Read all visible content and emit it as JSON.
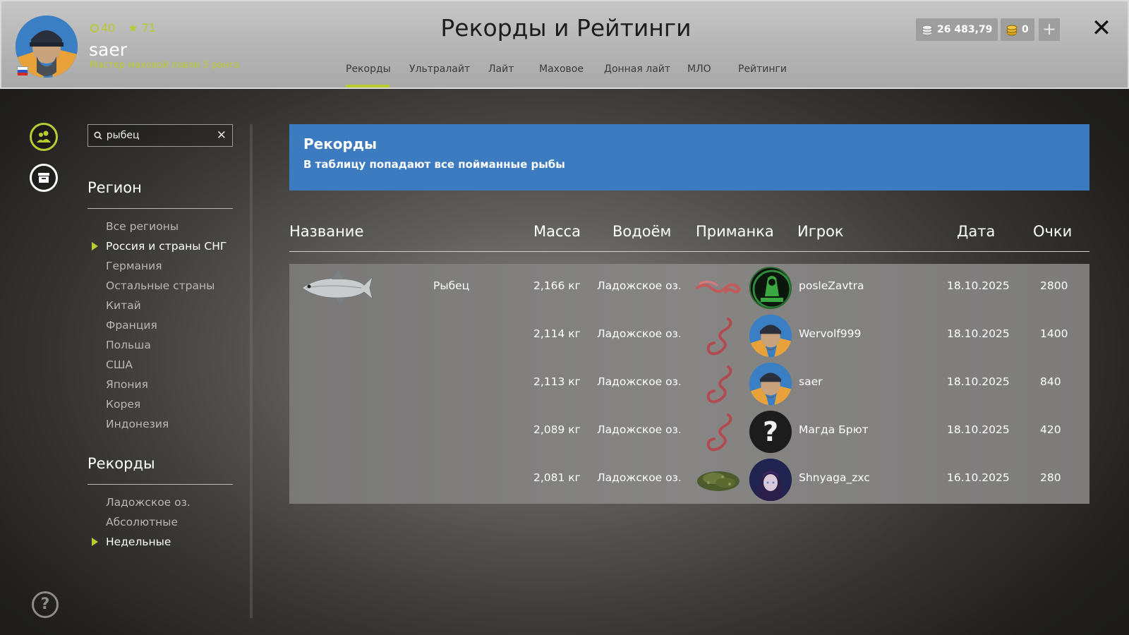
{
  "header": {
    "title": "Рекорды и Рейтинги",
    "player": {
      "level": "40",
      "stars": "71",
      "name": "saer",
      "rank": "Мастер маховой ловли 5 ранга"
    },
    "currency": {
      "silver": "26 483,79",
      "gold": "0"
    },
    "tabs": [
      "Рекорды",
      "Ультралайт",
      "Лайт",
      "Маховое",
      "Донная лайт",
      "МЛО",
      "Рейтинги"
    ],
    "active_tab": "Рекорды"
  },
  "search": {
    "value": "рыбец"
  },
  "region_section": {
    "title": "Регион",
    "items": [
      "Все регионы",
      "Россия и страны СНГ",
      "Германия",
      "Остальные страны",
      "Китай",
      "Франция",
      "Польша",
      "США",
      "Япония",
      "Корея",
      "Индонезия"
    ],
    "active": "Россия и страны СНГ"
  },
  "records_section": {
    "title": "Рекорды",
    "items": [
      "Ладожское оз.",
      "Абсолютные",
      "Недельные"
    ],
    "active": "Недельные"
  },
  "banner": {
    "title": "Рекорды",
    "subtitle": "В таблицу попадают все пойманные рыбы"
  },
  "table": {
    "columns": [
      "Название",
      "Масса",
      "Водоём",
      "Приманка",
      "Игрок",
      "Дата",
      "Очки"
    ],
    "fish_name": "Рыбец",
    "rows": [
      {
        "mass": "2,166 кг",
        "water": "Ладожское оз.",
        "bait": "worm-straight",
        "player": "posleZavtra",
        "avatar": "green-logo",
        "date": "18.10.2025",
        "points": "2800"
      },
      {
        "mass": "2,114 кг",
        "water": "Ладожское оз.",
        "bait": "worm-curled",
        "player": "Wervolf999",
        "avatar": "fisherman",
        "date": "18.10.2025",
        "points": "1400"
      },
      {
        "mass": "2,113 кг",
        "water": "Ладожское оз.",
        "bait": "worm-curled",
        "player": "saer",
        "avatar": "fisherman",
        "date": "18.10.2025",
        "points": "840"
      },
      {
        "mass": "2,089 кг",
        "water": "Ладожское оз.",
        "bait": "worm-curled",
        "player": "Магда Брют",
        "avatar": "unknown",
        "date": "18.10.2025",
        "points": "420"
      },
      {
        "mass": "2,081 кг",
        "water": "Ладожское оз.",
        "bait": "groundbait",
        "player": "Shnyaga_zxc",
        "avatar": "anime",
        "date": "16.10.2025",
        "points": "280"
      }
    ]
  },
  "colors": {
    "accent": "#b8cc30",
    "banner": "#3d7bc0"
  }
}
